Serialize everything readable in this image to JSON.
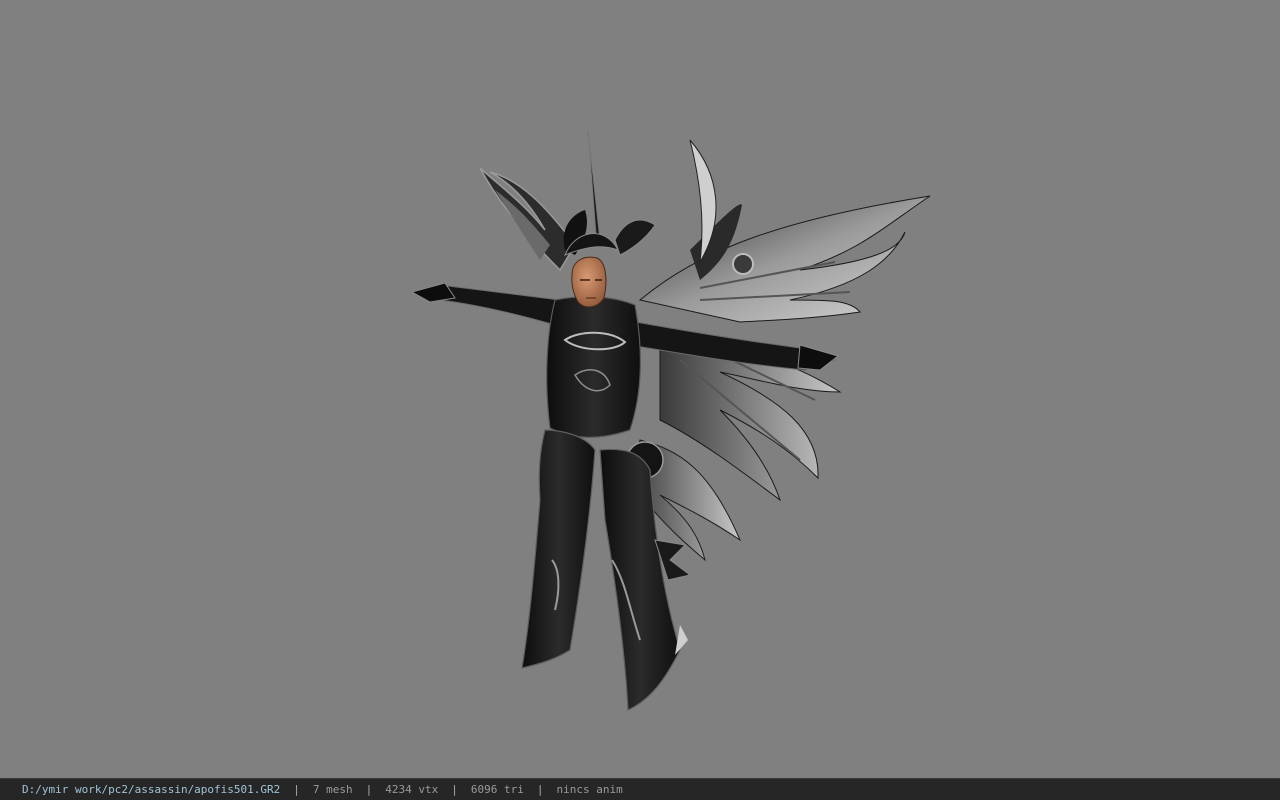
{
  "viewer": {
    "background_color": "#808080",
    "model_name": "apofis501",
    "model_description_icon": "armored-winged-character-model"
  },
  "status_bar": {
    "file_path": "D:/ymir work/pc2/assassin/apofis501.GR2",
    "separator": "|",
    "mesh": "7 mesh",
    "vertices": "4234 vtx",
    "triangles": "6096 tri",
    "animation": "nincs anim"
  }
}
